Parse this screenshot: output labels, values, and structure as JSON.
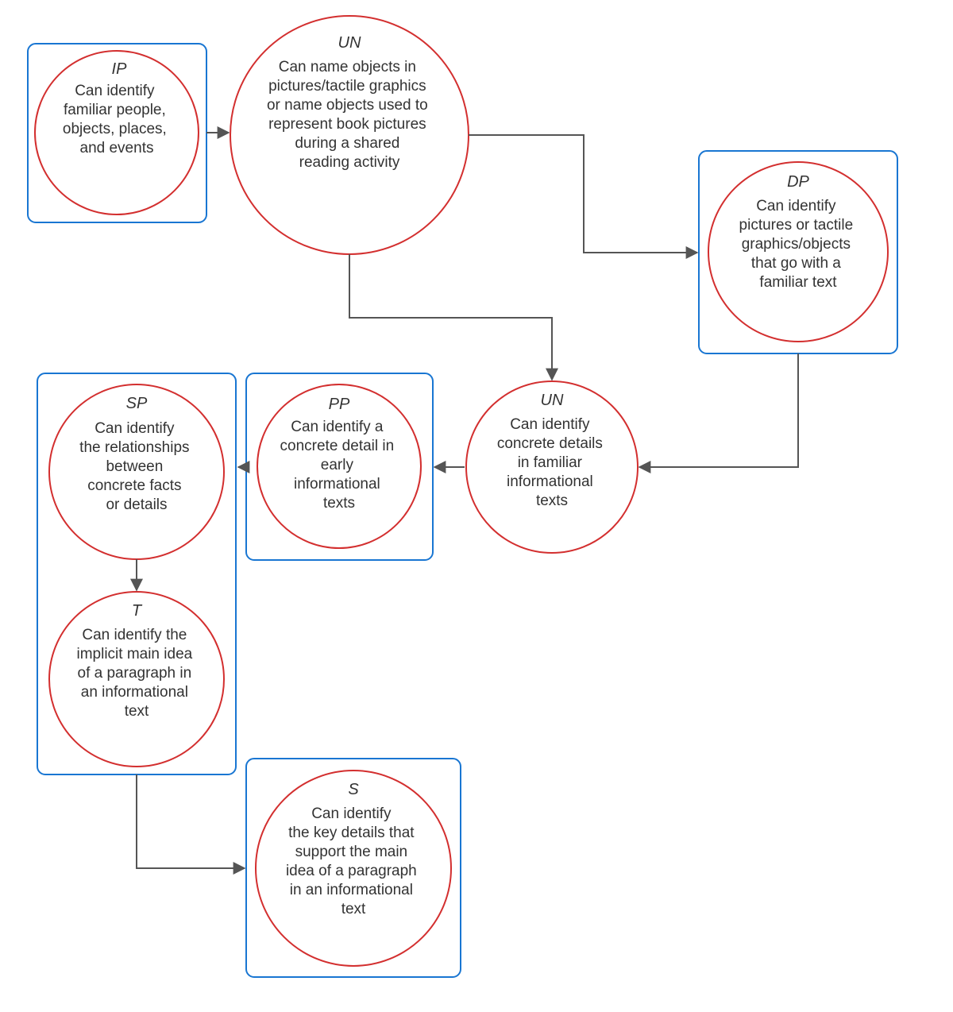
{
  "nodes": {
    "ip": {
      "code": "IP",
      "lines": [
        "Can identify",
        "familiar people,",
        "objects, places,",
        "and events"
      ]
    },
    "un1": {
      "code": "UN",
      "lines": [
        "Can name objects in",
        "pictures/tactile graphics",
        "or name objects used to",
        "represent book pictures",
        "during a shared",
        "reading activity"
      ]
    },
    "dp": {
      "code": "DP",
      "lines": [
        "Can identify",
        "pictures or tactile",
        "graphics/objects",
        "that go with a",
        "familiar text"
      ]
    },
    "un2": {
      "code": "UN",
      "lines": [
        "Can identify",
        "concrete details",
        "in familiar",
        "informational",
        "texts"
      ]
    },
    "pp": {
      "code": "PP",
      "lines": [
        "Can identify a",
        "concrete detail in",
        "early",
        "informational",
        "texts"
      ]
    },
    "sp": {
      "code": "SP",
      "lines": [
        "Can identify",
        "the relationships",
        "between",
        "concrete facts",
        "or details"
      ]
    },
    "t": {
      "code": "T",
      "lines": [
        "Can identify the",
        "implicit main idea",
        "of a paragraph in",
        "an informational",
        "text"
      ]
    },
    "s": {
      "code": "S",
      "lines": [
        "Can identify",
        "the key details that",
        "support the main",
        "idea of a paragraph",
        "in an informational",
        "text"
      ]
    }
  }
}
